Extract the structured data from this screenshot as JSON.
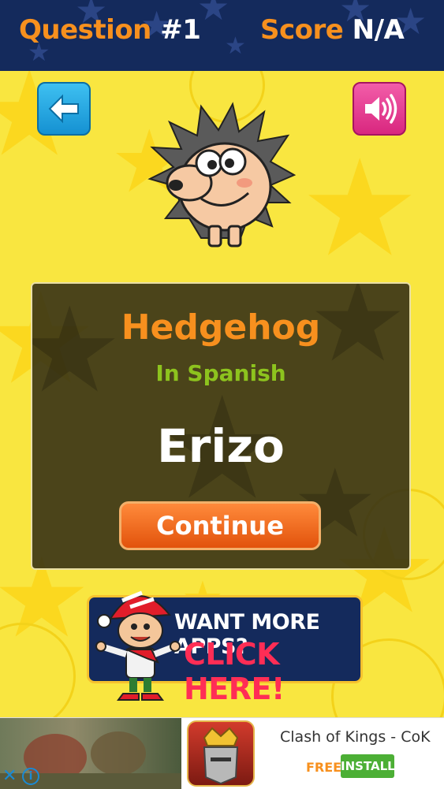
{
  "header": {
    "question_label": "Question",
    "question_number": "#1",
    "score_label": "Score",
    "score_value": "N/A"
  },
  "toolbar": {
    "back_icon": "arrow-left-icon",
    "sound_icon": "speaker-icon"
  },
  "card": {
    "word": "Hedgehog",
    "language": "In Spanish",
    "translation": "Erizo",
    "continue_label": "Continue"
  },
  "promo": {
    "line1": "WANT MORE APPS?",
    "line2": "CLICK HERE!"
  },
  "ad": {
    "title": "Clash of Kings - CoK",
    "free_label": "FREE",
    "install_label": "INSTALL"
  },
  "colors": {
    "header_bg": "#142a5c",
    "accent_orange": "#f7901e",
    "accent_green": "#8dc31e",
    "background_yellow": "#f9e640"
  }
}
